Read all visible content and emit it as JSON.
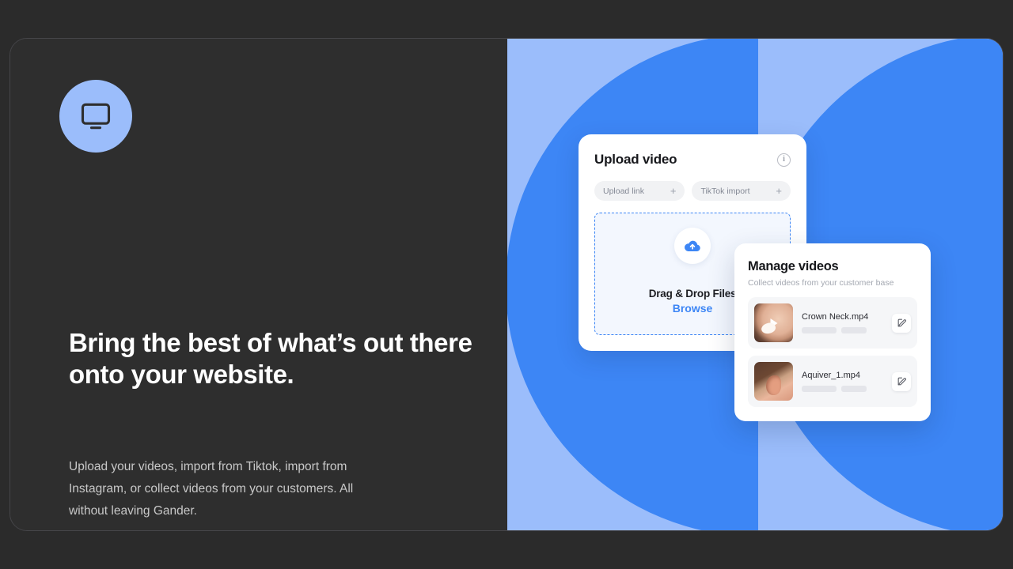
{
  "hero": {
    "badge_icon": "monitor-icon",
    "headline": "Bring the best of what’s out there onto your website.",
    "subcopy": "Upload your videos, import from Tiktok, import from Instagram, or collect videos from your customers. All without leaving Gander.",
    "accent_blue": "#3d86f5",
    "light_blue": "#9bbdfb",
    "panel_dark": "#2e2e2e"
  },
  "upload_card": {
    "title": "Upload video",
    "info_icon": "info-icon",
    "info_glyph": "i",
    "pills": [
      {
        "label": "Upload link",
        "plus": "+",
        "name": "upload-link"
      },
      {
        "label": "TikTok import",
        "plus": "+",
        "name": "tiktok-import"
      }
    ],
    "dropzone": {
      "icon": "cloud-upload-icon",
      "label": "Drag & Drop Files",
      "browse_label": "Browse"
    }
  },
  "manage_card": {
    "title": "Manage videos",
    "subtitle": "Collect videos from your customer base",
    "rows": [
      {
        "filename": "Crown Neck.mp4",
        "thumbnail": "woman-applying-cream-thumbnail",
        "play_icon": "play-icon",
        "edit_icon": "edit-icon"
      },
      {
        "filename": "Aquiver_1.mp4",
        "thumbnail": "ear-closeup-thumbnail",
        "play_icon": "play-icon",
        "edit_icon": "edit-icon"
      }
    ]
  }
}
